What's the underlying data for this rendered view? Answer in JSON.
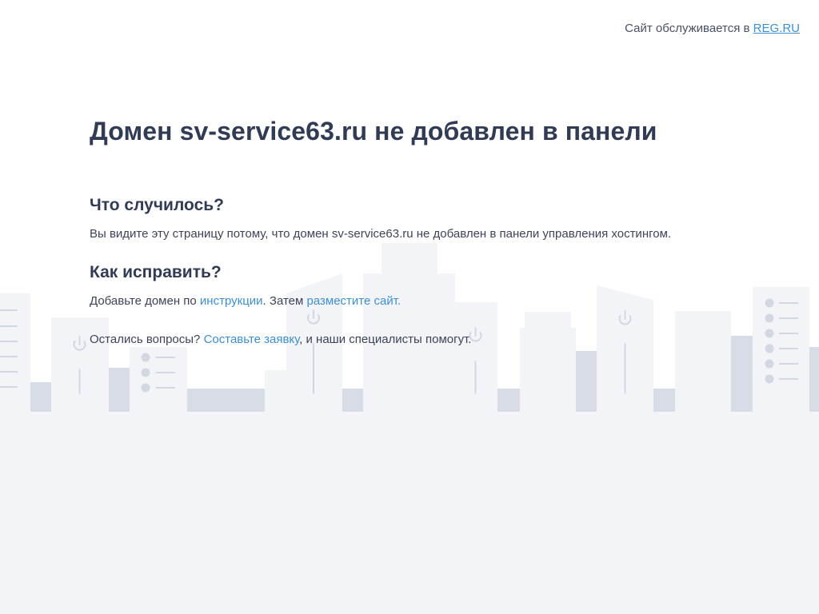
{
  "header": {
    "served_by_text": "Сайт обслуживается в ",
    "registrar_link": "REG.RU"
  },
  "main": {
    "title": "Домен sv-service63.ru не добавлен в панели",
    "what_happened": {
      "heading": "Что случилось?",
      "text": "Вы видите эту страницу потому, что домен sv-service63.ru не добавлен в панели управления хостингом."
    },
    "how_to_fix": {
      "heading": "Как исправить?",
      "text_before": "Добавьте домен по ",
      "instructions_link": "инструкции",
      "text_middle": ". Затем ",
      "place_site_link": "разместите сайт.",
      "text_after": ""
    },
    "questions": {
      "text_before": "Остались вопросы? ",
      "request_link": "Составьте заявку",
      "text_after": ", и наши специалисты помогут."
    }
  },
  "colors": {
    "heading": "#313b54",
    "text": "#3d4459",
    "link": "#3d8fce",
    "city_light": "#f3f4f8",
    "city_dark": "#d8dce6",
    "city_icon": "#d3d7e1"
  }
}
